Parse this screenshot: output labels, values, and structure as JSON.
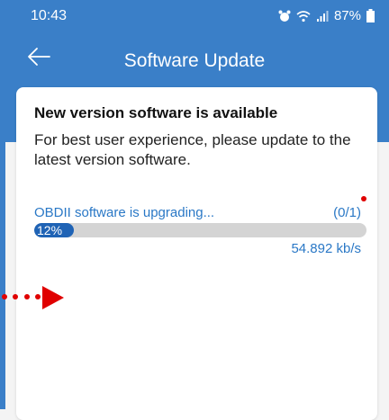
{
  "status_bar": {
    "time": "10:43",
    "battery": "87%"
  },
  "app_bar": {
    "title": "Software Update"
  },
  "dialog": {
    "title": "New version software is available",
    "message": "For best user experience, please update to the latest version software."
  },
  "progress": {
    "label": "OBDII software is upgrading...",
    "count": "(0/1)",
    "percent_text": "12%",
    "percent_value": 12,
    "speed": "54.892 kb/s"
  },
  "colors": {
    "primary": "#3a7fc8",
    "progress_fill": "#1f63b5",
    "progress_track": "#d4d4d4",
    "text_blue": "#2a78c6",
    "annotation_red": "#e00000"
  },
  "icons": [
    "back-arrow-icon",
    "alarm-icon",
    "wifi-icon",
    "signal-icon",
    "battery-icon"
  ]
}
